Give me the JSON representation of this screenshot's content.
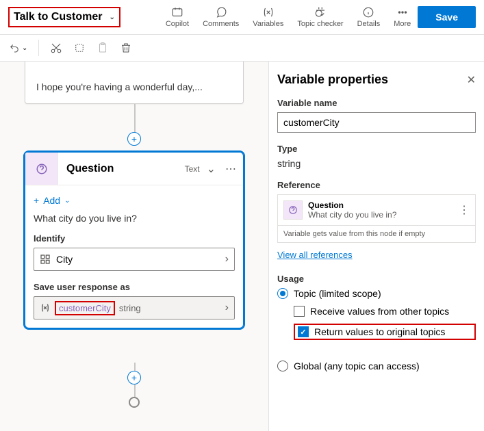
{
  "header": {
    "topic_name": "Talk to Customer",
    "toolbar": {
      "copilot": "Copilot",
      "comments": "Comments",
      "variables": "Variables",
      "topic_checker": "Topic checker",
      "details": "Details",
      "more": "More"
    },
    "save": "Save"
  },
  "canvas": {
    "message_preview": "I hope you're having a wonderful day,...",
    "question_card": {
      "title": "Question",
      "output_type": "Text",
      "add_label": "Add",
      "prompt": "What city do you live in?",
      "identify_label": "Identify",
      "identify_value": "City",
      "save_label": "Save user response as",
      "variable_name": "customerCity",
      "variable_type": "string"
    }
  },
  "panel": {
    "title": "Variable properties",
    "name_label": "Variable name",
    "name_value": "customerCity",
    "type_label": "Type",
    "type_value": "string",
    "reference_label": "Reference",
    "reference_title": "Question",
    "reference_subtitle": "What city do you live in?",
    "reference_note": "Variable gets value from this node if empty",
    "view_all": "View all references",
    "usage_label": "Usage",
    "usage_topic": "Topic (limited scope)",
    "usage_receive": "Receive values from other topics",
    "usage_return": "Return values to original topics",
    "usage_global": "Global (any topic can access)"
  }
}
